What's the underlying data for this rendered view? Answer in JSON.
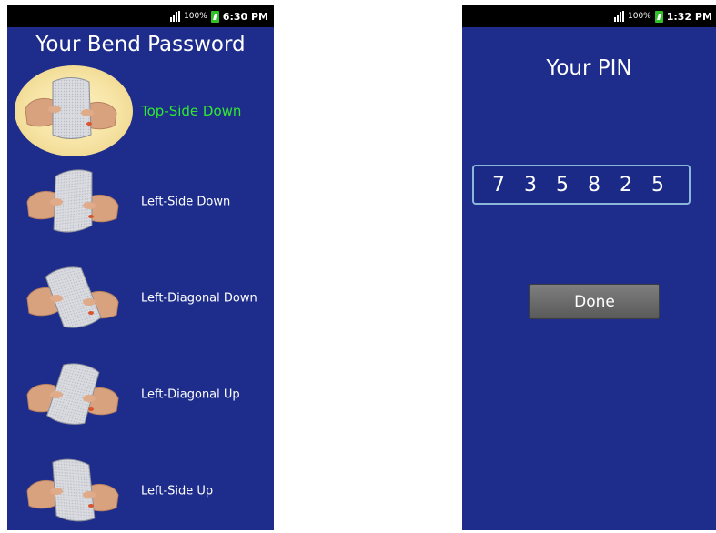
{
  "left_screen": {
    "status": {
      "battery_percent": "100%",
      "time": "6:30 PM"
    },
    "title": "Your Bend Password",
    "gestures": [
      {
        "label": "Top-Side Down",
        "selected": true
      },
      {
        "label": "Left-Side Down",
        "selected": false
      },
      {
        "label": "Left-Diagonal Down",
        "selected": false
      },
      {
        "label": "Left-Diagonal Up",
        "selected": false
      },
      {
        "label": "Left-Side Up",
        "selected": false
      }
    ],
    "icons": [
      "signal-icon",
      "battery-charging-icon",
      "bend-gesture-photo"
    ]
  },
  "right_screen": {
    "status": {
      "battery_percent": "100%",
      "time": "1:32 PM"
    },
    "title": "Your PIN",
    "pin": "735825",
    "done_label": "Done"
  },
  "colors": {
    "screen_background": "#1e2d8c",
    "selected_label": "#2fe82f",
    "pin_border": "#8bb8d8",
    "button": "#6b6b6b"
  }
}
